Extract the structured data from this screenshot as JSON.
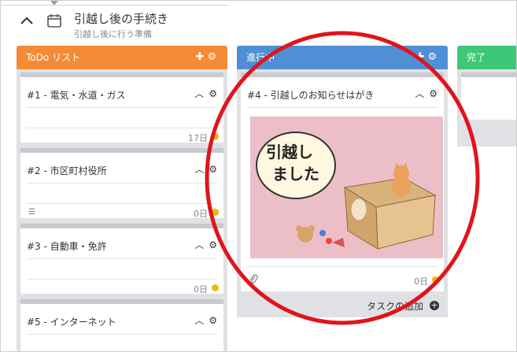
{
  "header": {
    "title": "引越し後の手続き",
    "subtitle": "引越し後に行う準備"
  },
  "columns": [
    {
      "name": "ToDo リスト",
      "color": "#f58b35",
      "cards": [
        {
          "title": "#1 - 電気・水道・ガス",
          "footer": "17日"
        },
        {
          "title": "#2 - 市区町村役所",
          "footer": "0日"
        },
        {
          "title": "#3 - 自動車・免許",
          "footer": "0日"
        },
        {
          "title": "#5 - インターネット",
          "footer": ""
        }
      ]
    },
    {
      "name": "進行中",
      "color": "#4f8fd6",
      "cards": [
        {
          "title": "#4 - 引越しのお知らせはがき",
          "footer": "0日",
          "image_text": "引越し ました"
        }
      ],
      "add_task": "タスクの追加"
    },
    {
      "name": "完了",
      "color": "#3dc776",
      "cards": []
    }
  ],
  "icons": {
    "collapse": "chevron-up-icon",
    "calendar": "calendar-icon",
    "add": "plus-icon",
    "settings": "gear-icon",
    "attachment": "paperclip-icon",
    "checklist": "list-icon",
    "due": "due-dot-icon"
  },
  "colors": {
    "highlight": "#e0141c",
    "due_dot": "#f2b705"
  }
}
